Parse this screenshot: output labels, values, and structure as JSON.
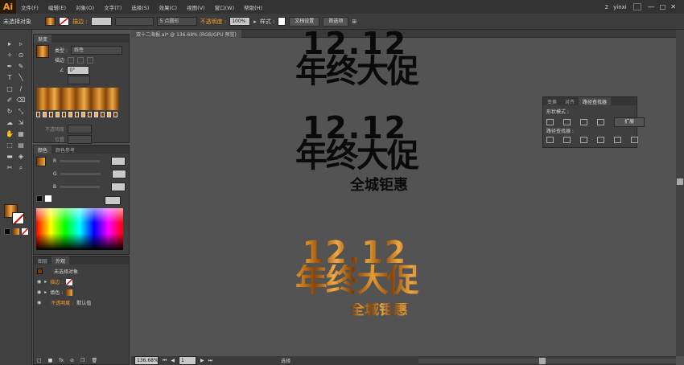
{
  "app": {
    "logo": "Ai"
  },
  "menu": [
    "文件(F)",
    "编辑(E)",
    "对象(O)",
    "文字(T)",
    "选择(S)",
    "效果(C)",
    "视图(V)",
    "窗口(W)",
    "帮助(H)"
  ],
  "menubar_right": {
    "badge": "2",
    "user": "yinxi"
  },
  "control": {
    "selection_state": "未选择对象",
    "stroke_label": "描边 :",
    "brush_value": "5 点圆形",
    "opacity_label": "不透明度 :",
    "opacity_value": "100%",
    "style_label": "样式 :",
    "doc_setup": "文档设置",
    "preferences": "首选项"
  },
  "document": {
    "tab_title": "双十二海报.ai* @ 136.68% (RGB/GPU 预览)",
    "zoom": "136.68%",
    "page": "1",
    "status": "选择"
  },
  "gradient_panel": {
    "tab": "渐变",
    "type_label": "类型 :",
    "type_value": "线性",
    "stroke_label": "描边",
    "angle_value": "0°",
    "opacity_label": "不透明度",
    "position_label": "位置"
  },
  "color_panel": {
    "tabs": [
      "颜色",
      "颜色参考"
    ],
    "channels": [
      "R",
      "G",
      "B"
    ]
  },
  "appearance_panel": {
    "tabs": [
      "图层",
      "外观"
    ],
    "title": "未选择对象",
    "rows": [
      {
        "label": "描边 :"
      },
      {
        "label": "填色 :"
      },
      {
        "label": "不透明度 :",
        "value": "默认值"
      }
    ]
  },
  "pathfinder_panel": {
    "tabs": [
      "变换",
      "对齐",
      "路径查找器"
    ],
    "shape_modes_label": "形状模式 :",
    "expand_button": "扩展",
    "pathfinders_label": "路径查找器 :"
  },
  "artwork": [
    {
      "line1": "12.12",
      "line2": "年终大促",
      "sub": "",
      "fill": "black"
    },
    {
      "line1": "12.12",
      "line2": "年终大促",
      "sub": "全城钜惠",
      "fill": "black"
    },
    {
      "line1": "12.12",
      "line2": "年终大促",
      "sub": "全城钜惠",
      "fill": "gold"
    }
  ],
  "colors": {
    "accent": "#f29b31",
    "gold_dark": "#7a3a04",
    "gold_light": "#f1aa43"
  }
}
